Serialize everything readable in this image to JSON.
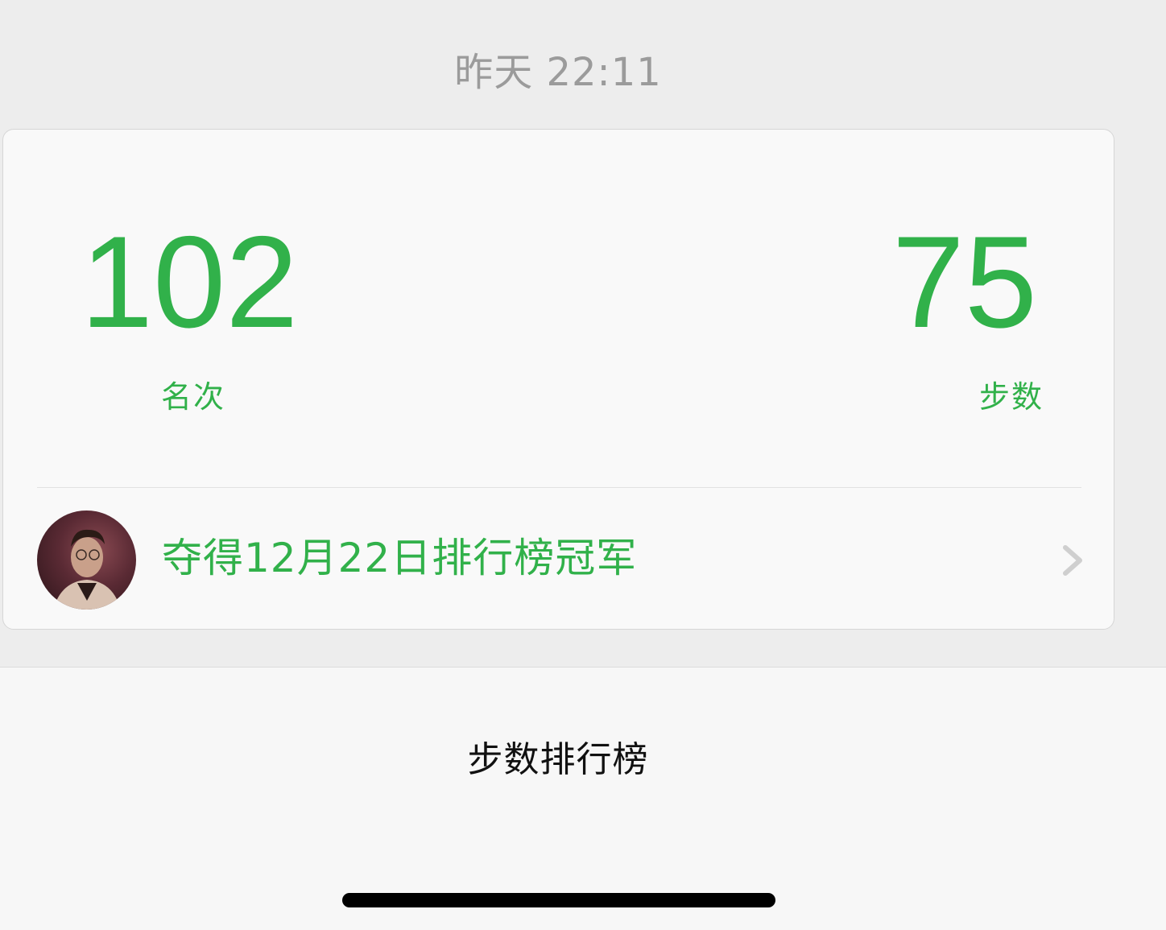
{
  "header": {
    "timestamp": "昨天 22:11"
  },
  "card": {
    "rank": {
      "value": "102",
      "label": "名次"
    },
    "steps": {
      "value": "75",
      "label": "步数"
    },
    "champion": {
      "text": "夺得12月22日排行榜冠军",
      "avatar_icon": "user-avatar",
      "chevron_icon": "chevron-right-icon"
    }
  },
  "footer": {
    "title": "步数排行榜"
  },
  "colors": {
    "accent": "#31b14a",
    "timestamp": "#9b9b9b",
    "background": "#ededed",
    "card_background": "#f9f9f9"
  }
}
